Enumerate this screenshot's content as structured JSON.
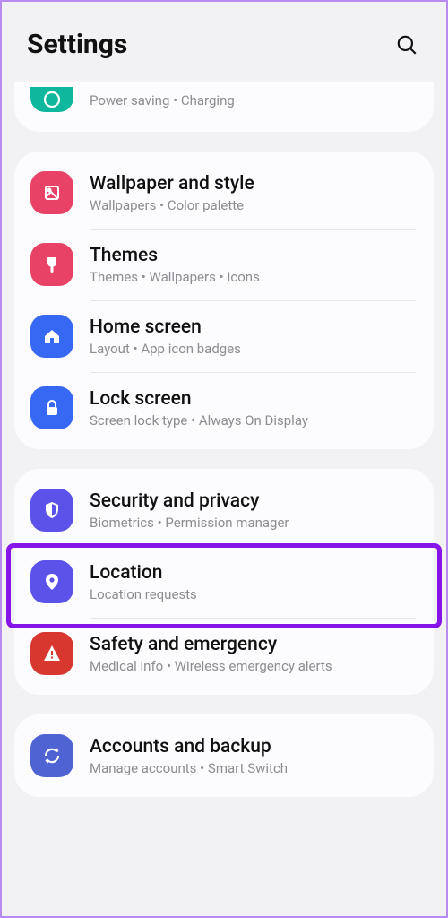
{
  "header": {
    "title": "Settings"
  },
  "colors": {
    "battery": "#0fb89c",
    "wallpaper": "#e84366",
    "themes": "#e84366",
    "home": "#3668f4",
    "lock": "#3668f4",
    "security": "#5b52ea",
    "location": "#5b52ea",
    "safety": "#d8372f",
    "accounts": "#4f63d2"
  },
  "group0": {
    "battery": {
      "sub": "Power saving  •  Charging"
    }
  },
  "group1": {
    "wallpaper": {
      "title": "Wallpaper and style",
      "sub": "Wallpapers  •  Color palette"
    },
    "themes": {
      "title": "Themes",
      "sub": "Themes  •  Wallpapers  •  Icons"
    },
    "home": {
      "title": "Home screen",
      "sub": "Layout  •  App icon badges"
    },
    "lock": {
      "title": "Lock screen",
      "sub": "Screen lock type  •  Always On Display"
    }
  },
  "group2": {
    "security": {
      "title": "Security and privacy",
      "sub": "Biometrics  •  Permission manager"
    },
    "location": {
      "title": "Location",
      "sub": "Location requests"
    },
    "safety": {
      "title": "Safety and emergency",
      "sub": "Medical info  •  Wireless emergency alerts"
    }
  },
  "group3": {
    "accounts": {
      "title": "Accounts and backup",
      "sub": "Manage accounts  •  Smart Switch"
    }
  }
}
